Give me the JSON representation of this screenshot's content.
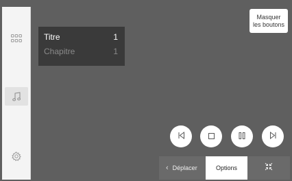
{
  "info_panel": {
    "row1_label": "Titre",
    "row1_value": "1",
    "row2_label": "Chapitre",
    "row2_value": "1"
  },
  "hide_buttons": {
    "line1": "Masquer",
    "line2": "les boutons"
  },
  "bottom_bar": {
    "move_label": "Déplacer",
    "options_label": "Options"
  },
  "sidebar": {
    "items": [
      "apps-grid-icon",
      "music-note-icon",
      "settings-gear-icon"
    ],
    "active": "music-note-icon"
  },
  "controls": [
    "previous-track-icon",
    "stop-icon",
    "pause-icon",
    "next-track-icon"
  ],
  "colors": {
    "background": "#5f5f5f",
    "panel": "#3a3a3a",
    "sidebar": "#f4f4f4",
    "button": "#ffffff"
  }
}
